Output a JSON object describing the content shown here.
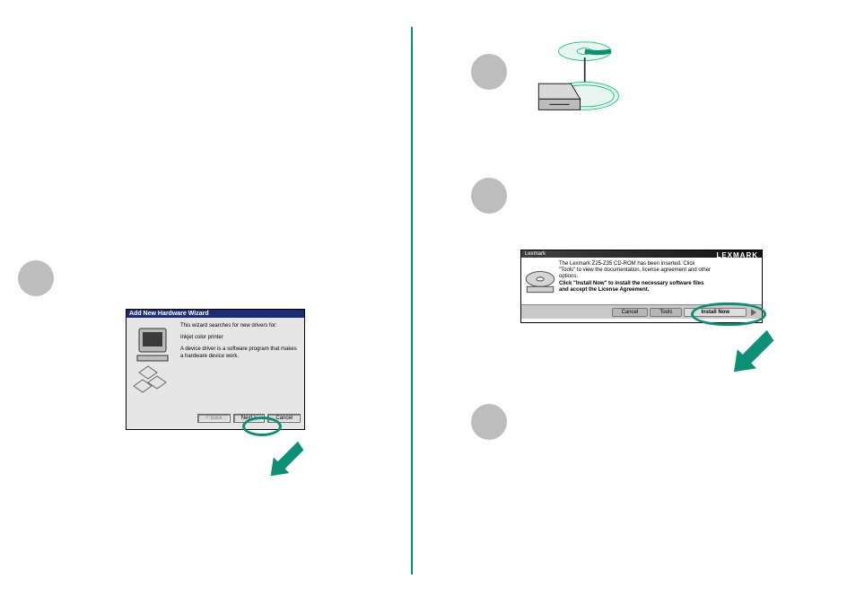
{
  "left": {
    "step1": {
      "wizard": {
        "title": "Add New Hardware Wizard",
        "line1": "This wizard searches for new drivers for:",
        "line2": "Inkjet color printer",
        "line3": "A device driver is a software program that makes a hardware device work.",
        "btn_back": "< Back",
        "btn_next": "Next >",
        "btn_cancel": "Cancel"
      }
    }
  },
  "right": {
    "step3": {
      "titlebar_app": "Lexmark",
      "titlebar_brand": "LEXMARK",
      "body_line1": "The Lexmark Z25-Z35 CD-ROM has been inserted. Click \"Tools\" to view the documentation, license agreement and other options.",
      "body_line2_bold": "Click \"Install Now\" to install the necessary software files and accept the License Agreement.",
      "btn_cancel": "Cancel",
      "btn_tools": "Tools",
      "btn_install": "Install Now"
    }
  },
  "colors": {
    "accent": "#0c9075",
    "neutral_dot": "#bdbdbd"
  },
  "icons": {
    "arrow": "pointer-arrow",
    "cd": "cd-into-drive",
    "wizard_pc": "computer-with-pages"
  }
}
